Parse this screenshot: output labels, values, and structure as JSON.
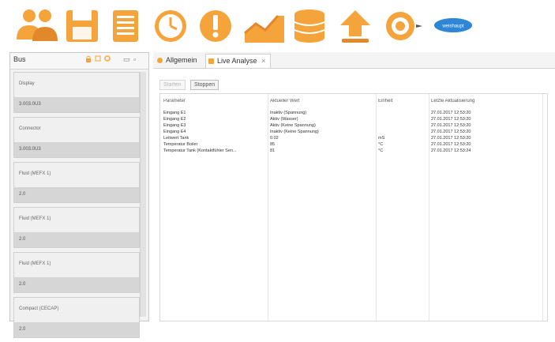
{
  "toolbar": {
    "icons": [
      "users-icon",
      "save-icon",
      "document-icon",
      "clock-icon",
      "alert-icon",
      "chart-icon",
      "database-icon",
      "upload-icon",
      "network-icon",
      "logo-icon"
    ],
    "logo_text": "weishaupt"
  },
  "left_panel": {
    "tab_label": "Bus",
    "controls": [
      "lock-icon",
      "square-icon",
      "gear-icon",
      "minimize-icon",
      "maximize-icon"
    ],
    "devices": [
      {
        "name": "Display",
        "value": "3.003.0U3"
      },
      {
        "name": "Connector",
        "value": "3.003.0U3"
      },
      {
        "name": "Fluid (MEFX 1)",
        "value": "2.0"
      },
      {
        "name": "Fluid (MEFX 1)",
        "value": "2.0"
      },
      {
        "name": "Fluid (MEFX 1)",
        "value": "2.0"
      },
      {
        "name": "Compact (CECAP)",
        "value": "2.0"
      }
    ]
  },
  "right_panel": {
    "tabs": [
      {
        "label": "Allgemein",
        "active": false
      },
      {
        "label": "Live Analyse",
        "active": true,
        "close": "×"
      }
    ],
    "buttons": [
      {
        "label": "Starten",
        "enabled": false
      },
      {
        "label": "Stoppen",
        "enabled": true
      }
    ],
    "table": {
      "headers": [
        "Parameter",
        "Aktueller Wert",
        "Einheit",
        "Letzte Aktualisierung"
      ],
      "rows": [
        [
          "Eingang E1",
          "Inaktiv (Spannung)",
          "",
          "27.01.2017 12:53:20"
        ],
        [
          "Eingang E2",
          "Aktiv (Wasser)",
          "",
          "27.01.2017 12:53:20"
        ],
        [
          "Eingang E3",
          "Aktiv (Keine Spannung)",
          "",
          "27.01.2017 12:53:20"
        ],
        [
          "Eingang E4",
          "Inaktiv (Keine Spannung)",
          "",
          "27.01.2017 12:53:20"
        ],
        [
          "Leitwert Tank",
          "0.02",
          "mS",
          "27.01.2017 12:53:20"
        ],
        [
          "Temperatur Boiler",
          "85",
          "°C",
          "27.01.2017 12:53:20"
        ],
        [
          "Temperatur Tank (Kontaktfühler Sen...",
          "81",
          "°C",
          "27.01.2017 12:53:24"
        ]
      ]
    }
  },
  "colors": {
    "orange": "#f4a43a",
    "orange_dark": "#e3872b",
    "blue": "#2f86d6",
    "panel_gray": "#d6d6d6"
  }
}
